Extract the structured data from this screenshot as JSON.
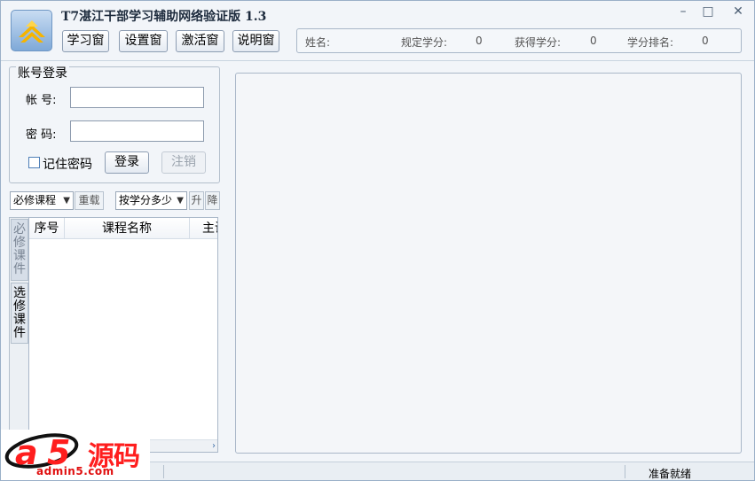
{
  "window": {
    "title": "T7湛江干部学习辅助网络验证版 1.3",
    "controls": {
      "minimize": "–",
      "maximize": "□",
      "close": "✕"
    }
  },
  "toolbar": {
    "buttons": [
      "学习窗",
      "设置窗",
      "激活窗",
      "说明窗"
    ]
  },
  "info": {
    "name_label": "姓名:",
    "name_value": "",
    "required_credits_label": "规定学分:",
    "required_credits_value": "0",
    "earned_credits_label": "获得学分:",
    "earned_credits_value": "0",
    "rank_label": "学分排名:",
    "rank_value": "0"
  },
  "login": {
    "group_title": "账号登录",
    "account_label": "帐  号:",
    "account_value": "",
    "password_label": "密  码:",
    "password_value": "",
    "remember_label": "记住密码",
    "remember_checked": false,
    "login_button": "登录",
    "logout_button": "注销"
  },
  "filters": {
    "course_type_selected": "必修课程",
    "reload_button": "重载",
    "sort_selected": "按学分多少",
    "asc_button": "升",
    "desc_button": "降"
  },
  "course_tabs": [
    "必修课件",
    "选修课件"
  ],
  "course_list": {
    "columns": [
      "序号",
      "课程名称",
      "主讲"
    ],
    "rows": []
  },
  "status_bar": {
    "text": "准备就绪"
  },
  "watermark": {
    "logo_text": "a5源码",
    "site": "admin5.com"
  },
  "colors": {
    "window_bg": "#f2f5f9",
    "border": "#a9b7c8",
    "watermark_red": "#ff1e1e"
  }
}
